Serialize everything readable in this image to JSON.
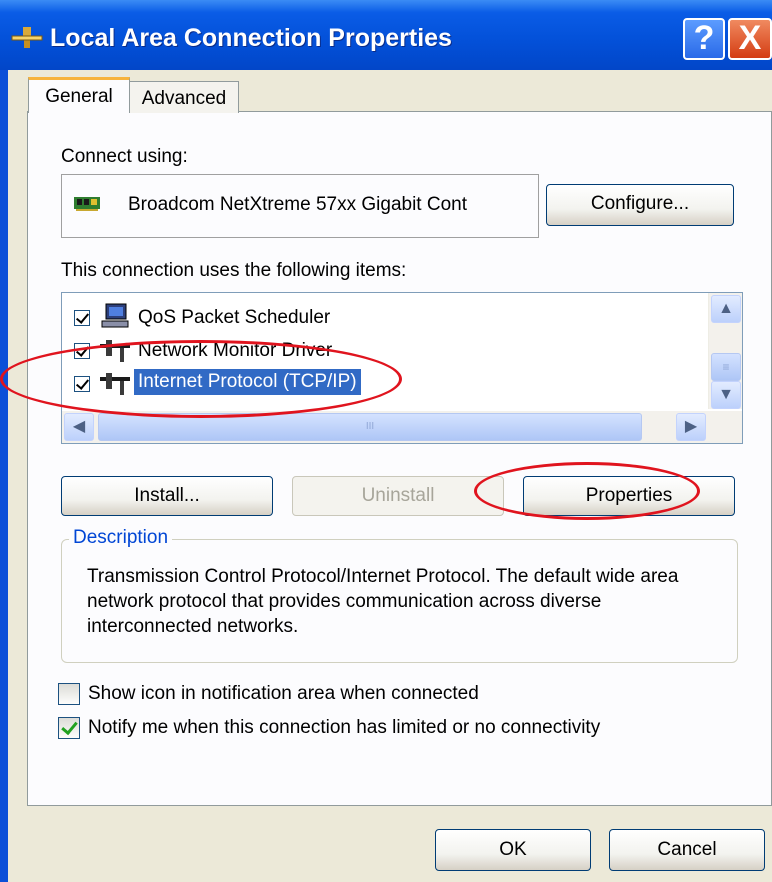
{
  "window": {
    "title": "Local Area Connection Properties",
    "help_label": "?",
    "close_label": "X"
  },
  "tabs": [
    {
      "label": "General",
      "selected": true
    },
    {
      "label": "Advanced",
      "selected": false
    }
  ],
  "general": {
    "connect_using_label": "Connect using:",
    "adapter_name": "Broadcom NetXtreme 57xx Gigabit Cont",
    "configure_label": "Configure...",
    "items_label": "This connection uses the following items:",
    "items": [
      {
        "label": "QoS Packet Scheduler",
        "checked": true,
        "icon": "network-client-icon",
        "selected": false
      },
      {
        "label": "Network Monitor Driver",
        "checked": true,
        "icon": "network-protocol-icon",
        "selected": false
      },
      {
        "label": "Internet Protocol (TCP/IP)",
        "checked": true,
        "icon": "network-protocol-icon",
        "selected": true
      }
    ],
    "scroll_glyph": "III",
    "install_label": "Install...",
    "uninstall_label": "Uninstall",
    "properties_label": "Properties",
    "description_legend": "Description",
    "description_text": "Transmission Control Protocol/Internet Protocol. The default wide area network protocol that provides communication across diverse interconnected networks.",
    "show_icon_label": "Show icon in notification area when connected",
    "show_icon_checked": false,
    "notify_label": "Notify me when this connection has limited or no connectivity",
    "notify_checked": true
  },
  "footer": {
    "ok_label": "OK",
    "cancel_label": "Cancel"
  },
  "colors": {
    "title_bar": "#0350d8",
    "selection": "#316ac5",
    "annotation": "#e0141e",
    "legend_text": "#0046d5"
  }
}
